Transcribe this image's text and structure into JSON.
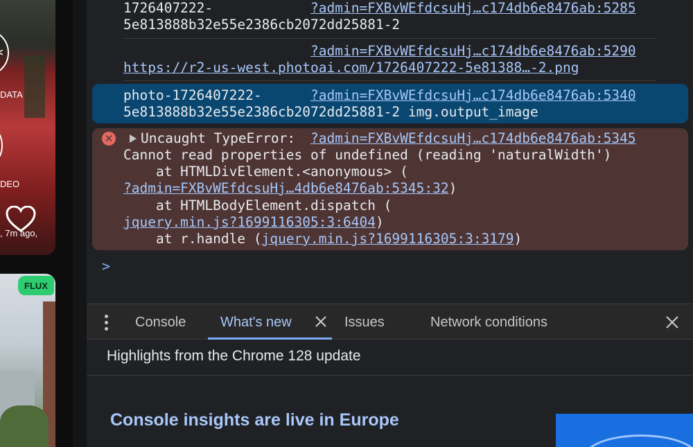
{
  "page": {
    "labels": {
      "data": "DATA",
      "video": "DEO",
      "time_ago": ", 7m ago,"
    },
    "badge": "FLUX",
    "accent": "#2ecc71"
  },
  "console": {
    "messages": [
      {
        "text_lines": [
          "1726407222-",
          "5e813888b32e55e2386cb2072dd25881-2"
        ],
        "source": "?admin=FXBvWEfdcsuHj…c174db6e8476ab:5285"
      },
      {
        "text_lines": [
          "",
          "https://r2-us-west.photoai.com/1726407222-5e81388…-2.png"
        ],
        "source": "?admin=FXBvWEfdcsuHj…c174db6e8476ab:5290"
      },
      {
        "text_lines": [
          "photo-1726407222-",
          "5e813888b32e55e2386cb2072dd25881-2 img.output_image"
        ],
        "source": "?admin=FXBvWEfdcsuHj…c174db6e8476ab:5340",
        "selected": true
      }
    ],
    "error": {
      "title": "Uncaught TypeError:",
      "source": "?admin=FXBvWEfdcsuHj…c174db6e8476ab:5345",
      "message": "Cannot read properties of undefined (reading 'naturalWidth')",
      "stack": [
        {
          "prefix": "    at HTMLDivElement.<anonymous> (",
          "link": "?admin=FXBvWEfdcsuHj…4db6e8476ab:5345:32",
          "suffix": ")"
        },
        {
          "prefix": "    at HTMLBodyElement.dispatch (",
          "link": "jquery.min.js?1699116305:3:6404",
          "suffix": ")"
        },
        {
          "prefix": "    at r.handle (",
          "link": "jquery.min.js?1699116305:3:3179",
          "suffix": ")"
        }
      ]
    },
    "prompt": ">"
  },
  "drawer": {
    "tabs": [
      "Console",
      "What's new",
      "Issues",
      "Network conditions"
    ],
    "active_tab": "What's new",
    "highlights": "Highlights from the Chrome 128 update",
    "insight_title": "Console insights are live in Europe"
  },
  "colors": {
    "selected": "#094771",
    "error_bg": "#4e3534",
    "link": "#a8c7fa",
    "error_icon": "#e46962"
  },
  "icons": [
    "error-icon",
    "expand-triangle-icon",
    "kebab-menu-icon",
    "close-icon",
    "heart-icon",
    "prompt-chevron-icon"
  ]
}
